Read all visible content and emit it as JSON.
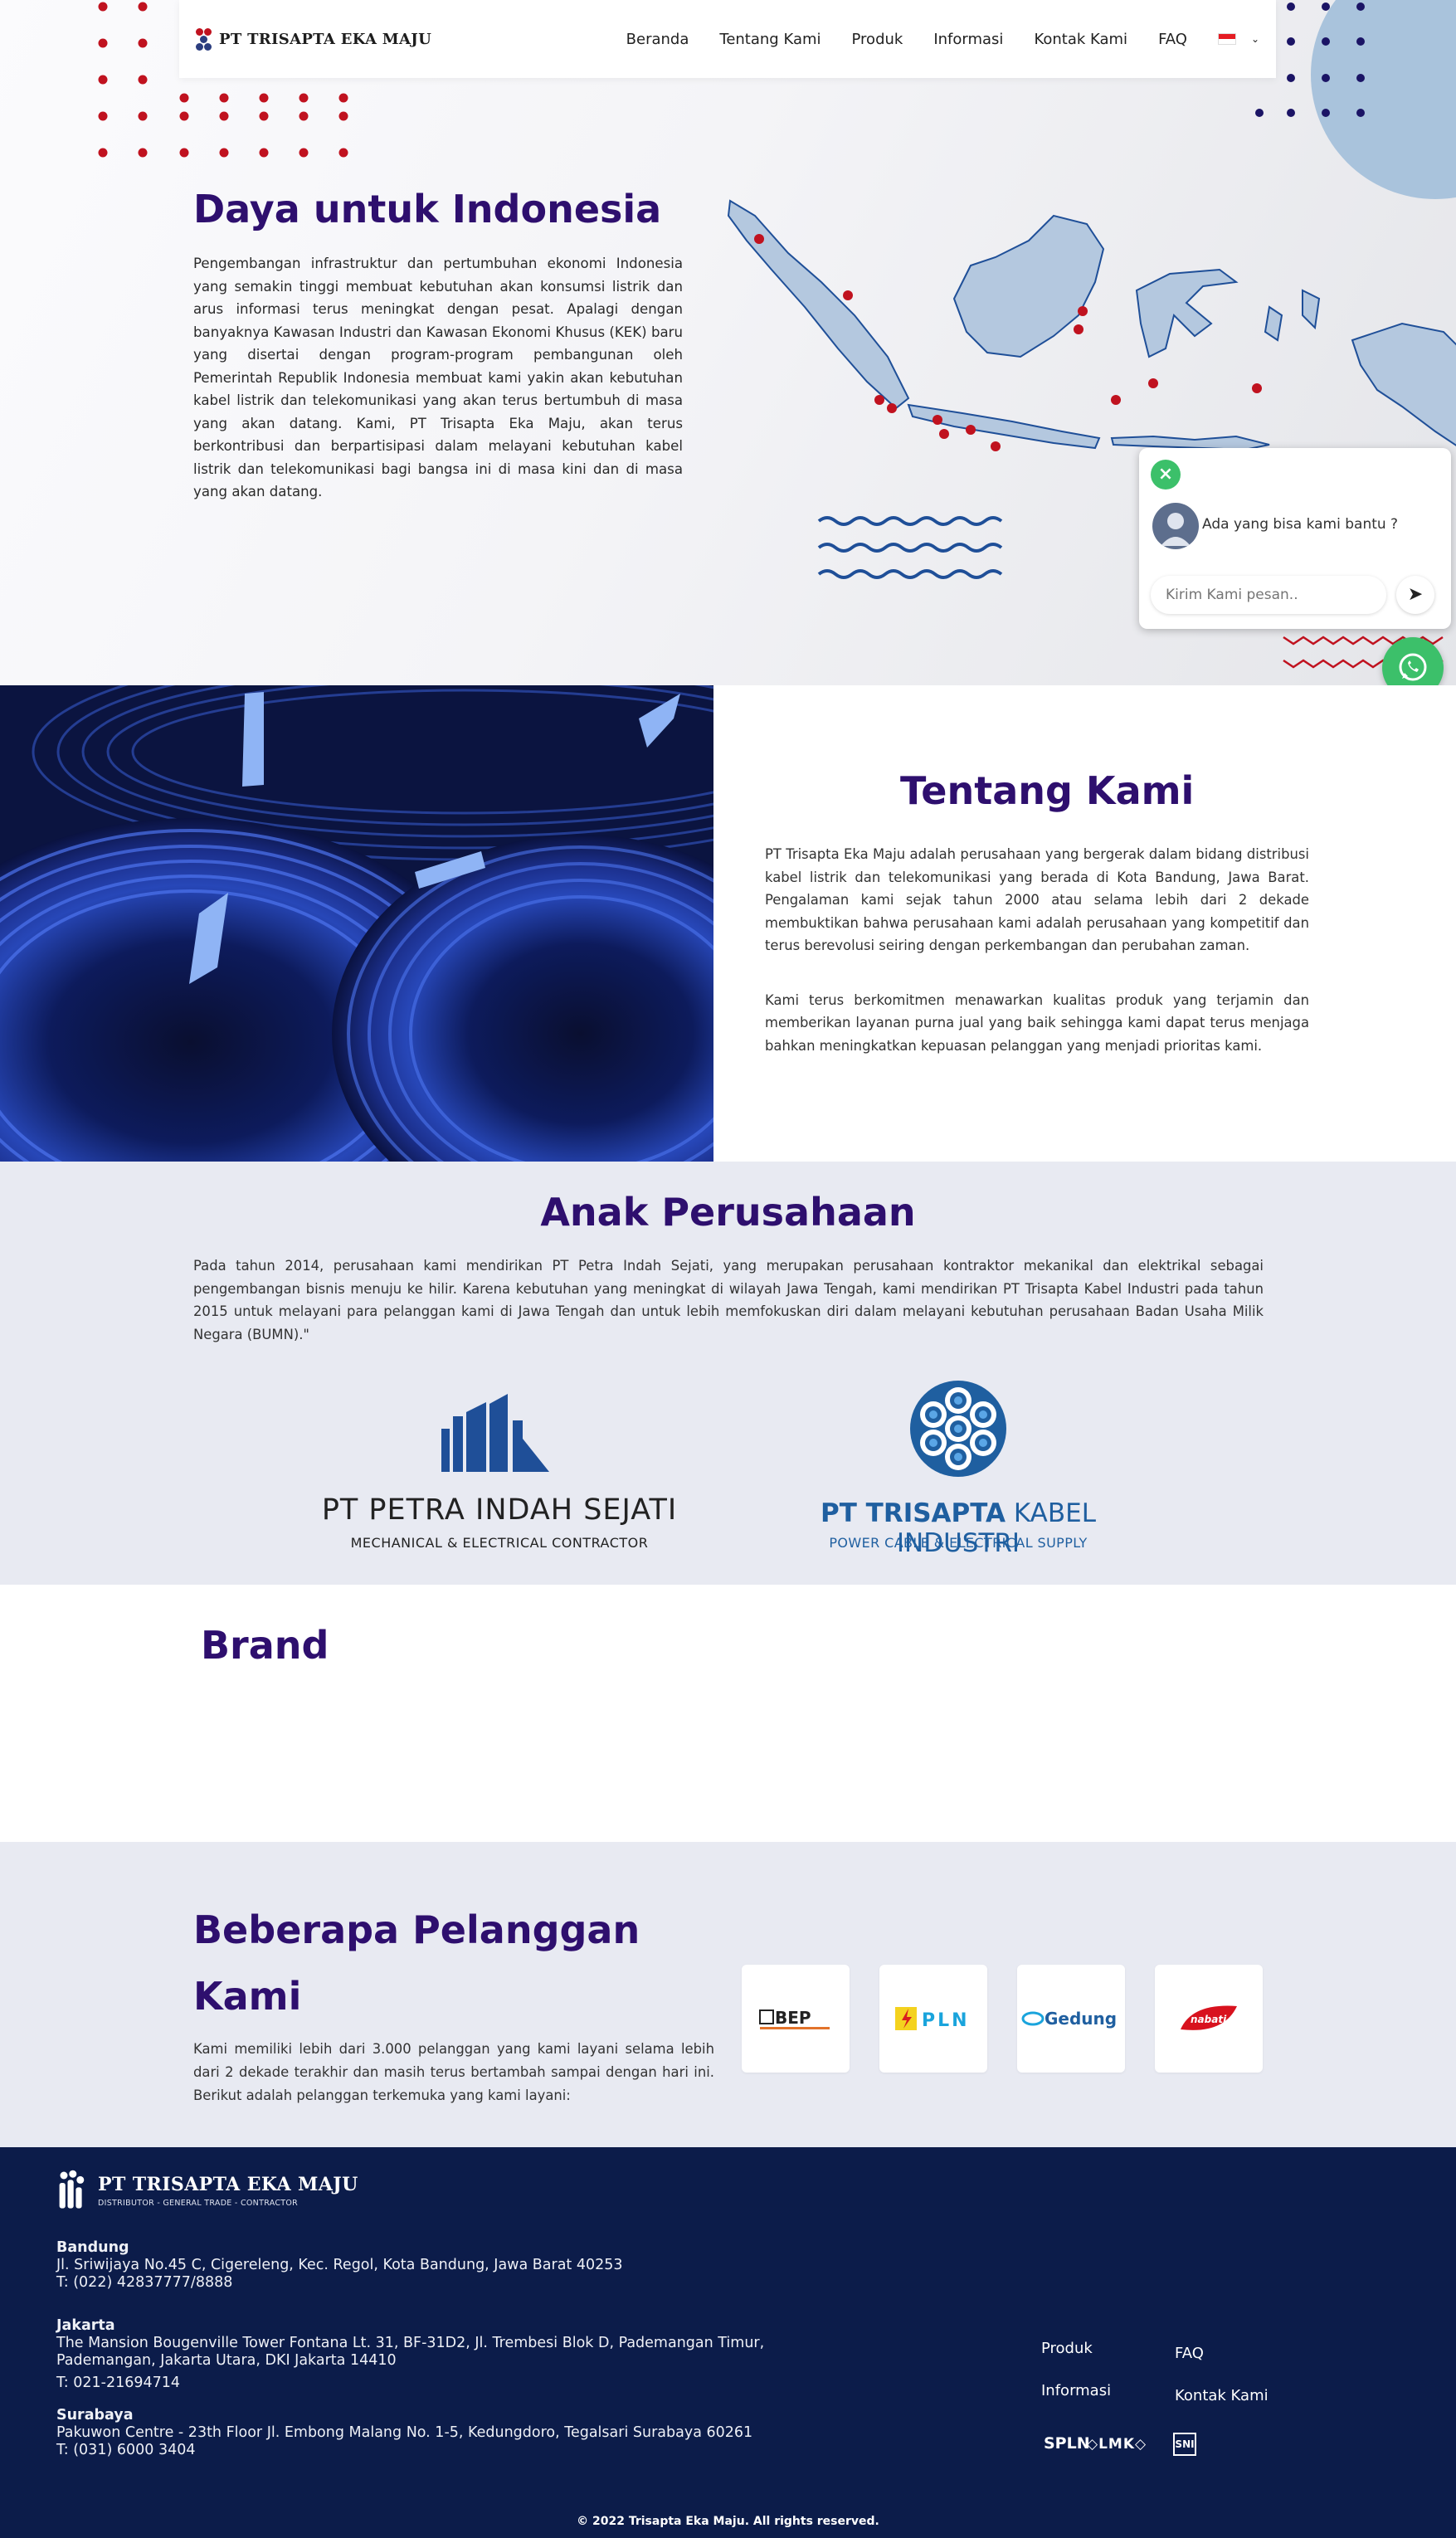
{
  "navbar": {
    "brand": "PT TRISAPTA EKA MAJU",
    "menu": [
      "Beranda",
      "Tentang Kami",
      "Produk",
      "Informasi",
      "Kontak Kami",
      "FAQ"
    ]
  },
  "hero": {
    "title": "Daya untuk Indonesia",
    "text": "Pengembangan infrastruktur dan pertumbuhan ekonomi Indonesia yang semakin tinggi membuat kebutuhan akan konsumsi listrik dan arus informasi terus meningkat dengan pesat. Apalagi dengan banyaknya Kawasan Industri dan Kawasan Ekonomi Khusus (KEK) baru yang disertai dengan program-program pembangunan oleh Pemerintah Republik Indonesia membuat kami yakin akan kebutuhan kabel listrik dan telekomunikasi yang akan terus bertumbuh di masa yang akan datang. Kami, PT Trisapta Eka Maju, akan terus berkontribusi dan berpartisipasi dalam melayani kebutuhan kabel listrik dan telekomunikasi bagi bangsa ini di masa kini dan di masa yang akan datang."
  },
  "chat": {
    "message": "Ada yang bisa kami bantu ?",
    "placeholder": "Kirim Kami pesan.."
  },
  "about": {
    "title": "Tentang Kami",
    "paragraph1": "PT Trisapta Eka Maju adalah perusahaan yang bergerak dalam bidang distribusi kabel listrik dan telekomunikasi yang berada di Kota Bandung, Jawa Barat. Pengalaman kami sejak tahun 2000 atau selama lebih dari 2 dekade membuktikan bahwa perusahaan kami adalah perusahaan yang kompetitif dan terus berevolusi seiring dengan perkembangan dan perubahan zaman.",
    "paragraph2": "Kami terus berkomitmen menawarkan kualitas produk yang terjamin dan memberikan layanan purna jual yang baik sehingga kami dapat terus menjaga bahkan meningkatkan kepuasan pelanggan yang menjadi prioritas kami."
  },
  "subsidiary": {
    "title": "Anak Perusahaan",
    "text": "Pada tahun 2014, perusahaan kami mendirikan PT Petra Indah Sejati, yang merupakan perusahaan kontraktor mekanikal dan elektrikal sebagai pengembangan bisnis menuju ke hilir. Karena kebutuhan yang meningkat di wilayah Jawa Tengah, kami mendirikan PT Trisapta Kabel Industri pada tahun 2015 untuk melayani para pelanggan kami di Jawa Tengah dan untuk lebih memfokuskan diri dalam melayani kebutuhan perusahaan Badan Usaha Milik Negara (BUMN).\"",
    "petra_name": "PT PETRA INDAH SEJATI",
    "petra_tagline": "MECHANICAL & ELECTRICAL CONTRACTOR",
    "tki_name_bold": "PT TRISAPTA",
    "tki_name_rest": "KABEL INDUSTRI",
    "tki_tagline": "POWER CABLE & ELECTRICAL SUPPLY"
  },
  "brand": {
    "title": "Brand"
  },
  "clients": {
    "title": "Beberapa Pelanggan Kami",
    "text": "Kami memiliki lebih dari 3.000 pelanggan yang kami layani selama lebih dari 2 dekade terakhir dan masih terus bertambah sampai dengan hari ini. Berikut adalah pelanggan terkemuka yang kami layani:",
    "logos": [
      "BEP",
      "PLN",
      "Gedung",
      "nabati"
    ]
  },
  "footer": {
    "brand": "PT TRISAPTA EKA MAJU",
    "tagline": "DISTRIBUTOR - GENERAL TRADE - CONTRACTOR",
    "offices": [
      {
        "city": "Bandung",
        "address": "Jl. Sriwijaya No.45 C, Cigereleng, Kec. Regol, Kota Bandung, Jawa Barat 40253",
        "phone": "T:  (022) 42837777/8888"
      },
      {
        "city": "Jakarta",
        "address": "The Mansion Bougenville Tower Fontana Lt. 31, BF-31D2, Jl. Trembesi Blok D, Pademangan Timur, Pademangan, Jakarta Utara, DKI Jakarta 14410",
        "phone": "T: 021-21694714"
      },
      {
        "city": "Surabaya",
        "address": "Pakuwon Centre - 23th Floor Jl. Embong Malang No. 1-5, Kedungdoro, Tegalsari Surabaya 60261",
        "phone": "T: (031) 6000 3404"
      }
    ],
    "links": [
      "Produk",
      "FAQ",
      "Informasi",
      "Kontak Kami"
    ],
    "certs": [
      "SPLN",
      "LMK",
      "SNI"
    ],
    "copyright": "© 2022 Trisapta Eka Maju. All rights reserved."
  }
}
